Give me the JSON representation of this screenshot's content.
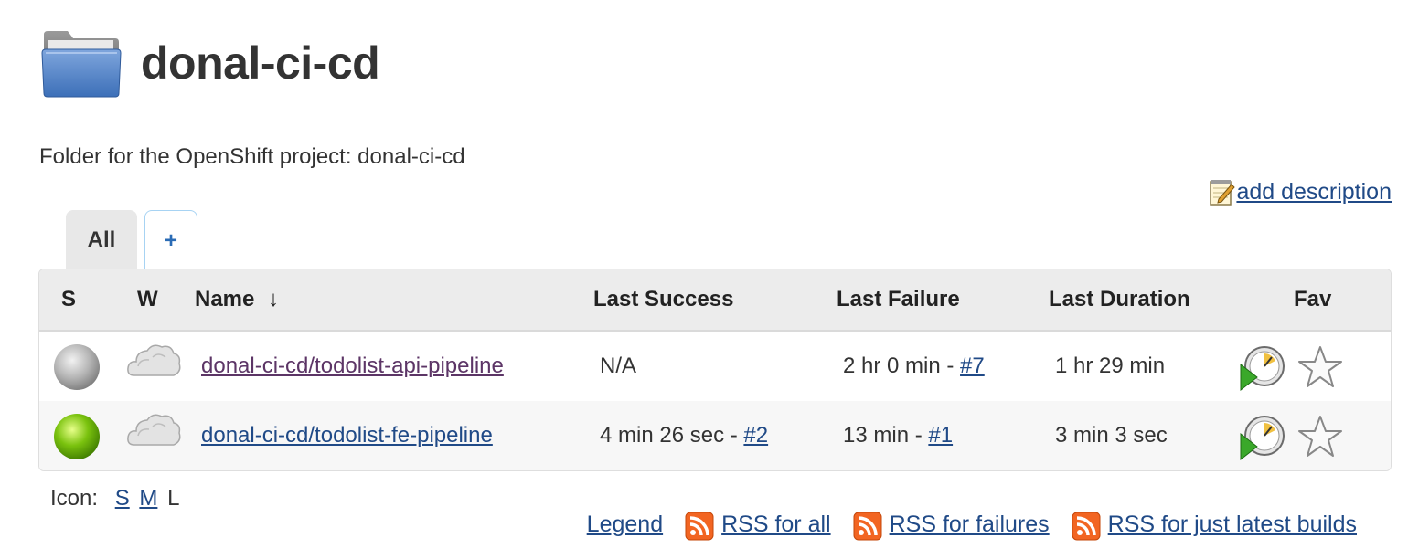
{
  "header": {
    "title": "donal-ci-cd",
    "icon": "folder-icon"
  },
  "description": "Folder for the OpenShift project: donal-ci-cd",
  "add_description_label": "add description",
  "tabs": [
    {
      "label": "All",
      "active": true
    },
    {
      "label": "+",
      "active": false
    }
  ],
  "table": {
    "headers": {
      "status": "S",
      "weather": "W",
      "name": "Name",
      "sort_arrow": "↓",
      "last_success": "Last Success",
      "last_failure": "Last Failure",
      "last_duration": "Last Duration",
      "fav": "Fav"
    },
    "rows": [
      {
        "status": "grey-ball-icon",
        "weather": "cloudy-icon",
        "name": "donal-ci-cd/todolist-api-pipeline",
        "last_success_text": "N/A",
        "last_success_link": "",
        "last_failure_text": "2 hr 0 min - ",
        "last_failure_link": "#7",
        "last_duration": "1 hr 29 min"
      },
      {
        "status": "green-ball-icon",
        "weather": "cloudy-icon",
        "name": "donal-ci-cd/todolist-fe-pipeline",
        "last_success_text": "4 min 26 sec - ",
        "last_success_link": "#2",
        "last_failure_text": "13 min - ",
        "last_failure_link": "#1",
        "last_duration": "3 min 3 sec"
      }
    ]
  },
  "icon_size": {
    "label": "Icon:",
    "small": "S",
    "medium": "M",
    "large": "L"
  },
  "footer_links": {
    "legend": "Legend",
    "rss_all": "RSS for all",
    "rss_failures": "RSS for failures",
    "rss_latest": "RSS for just latest builds"
  },
  "colors": {
    "link": "#204a87",
    "visited_link": "#5c3566",
    "header_bg": "#ececec",
    "success_ball": "#7ac20e",
    "rss": "#f26522"
  }
}
